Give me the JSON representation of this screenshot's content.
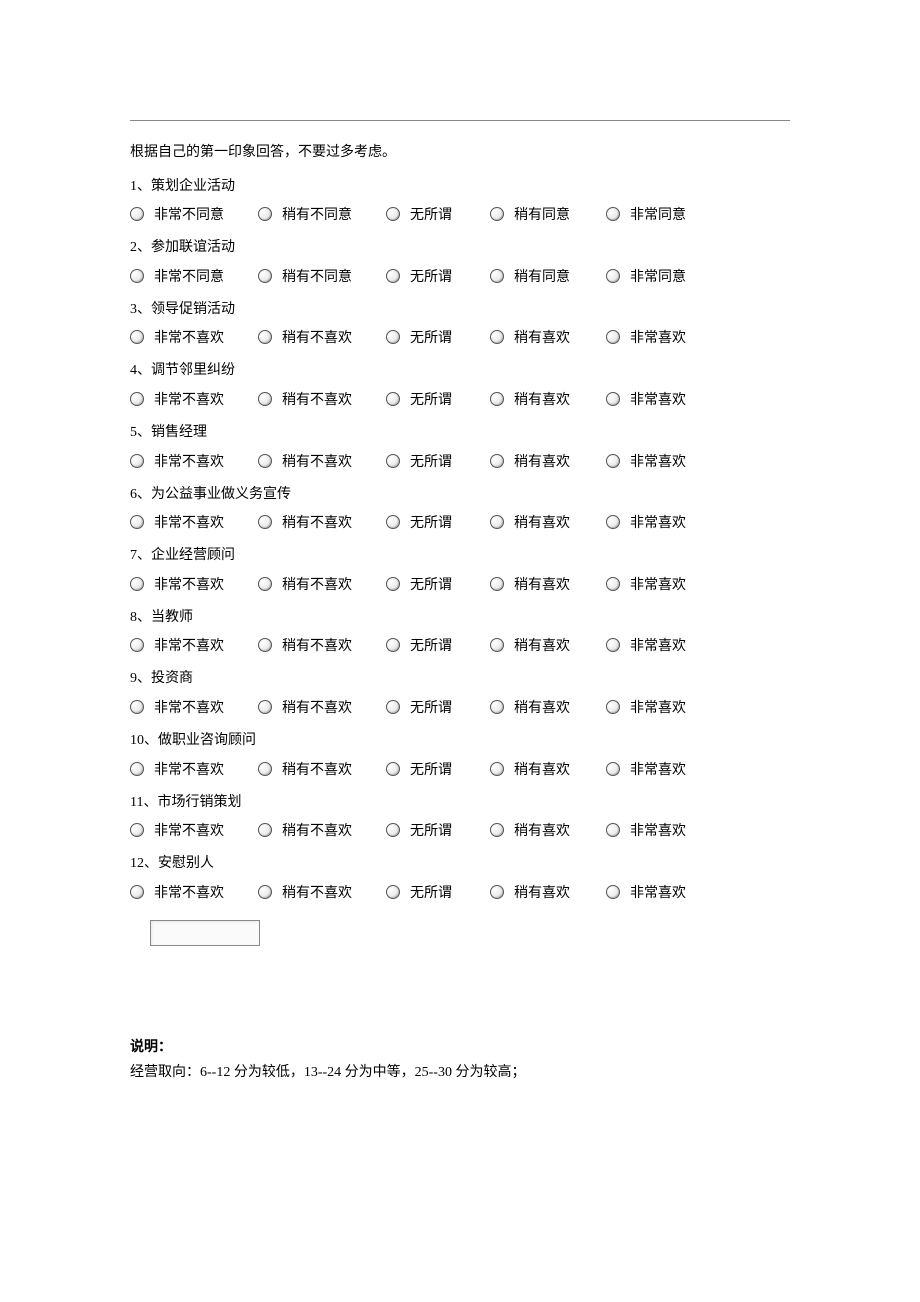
{
  "instruction": "根据自己的第一印象回答，不要过多考虑。",
  "optionsAgree": [
    "非常不同意",
    "稍有不同意",
    "无所谓",
    "稍有同意",
    "非常同意"
  ],
  "optionsLike": [
    "非常不喜欢",
    "稍有不喜欢",
    "无所谓",
    "稍有喜欢",
    "非常喜欢"
  ],
  "questions": [
    {
      "num": "1、",
      "text": "策划企业活动",
      "set": "agree"
    },
    {
      "num": "2、",
      "text": "参加联谊活动",
      "set": "agree"
    },
    {
      "num": "3、",
      "text": "领导促销活动",
      "set": "like"
    },
    {
      "num": "4、",
      "text": "调节邻里纠纷",
      "set": "like"
    },
    {
      "num": "5、",
      "text": "销售经理",
      "set": "like"
    },
    {
      "num": "6、",
      "text": "为公益事业做义务宣传",
      "set": "like"
    },
    {
      "num": "7、",
      "text": "企业经营顾问",
      "set": "like"
    },
    {
      "num": "8、",
      "text": "当教师",
      "set": "like"
    },
    {
      "num": "9、",
      "text": "投资商",
      "set": "like"
    },
    {
      "num": "10、",
      "text": "做职业咨询顾问",
      "set": "like"
    },
    {
      "num": "11、",
      "text": "市场行销策划",
      "set": "like"
    },
    {
      "num": "12、",
      "text": "安慰别人",
      "set": "like"
    }
  ],
  "explainTitle": "说明：",
  "explainText": "经营取向：6--12 分为较低，13--24 分为中等，25--30 分为较高；"
}
